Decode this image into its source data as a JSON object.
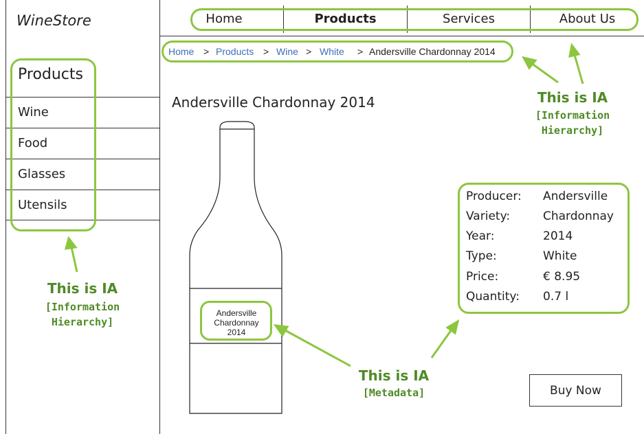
{
  "brand": "WineStore",
  "nav": [
    {
      "label": "Home",
      "active": false
    },
    {
      "label": "Products",
      "active": true
    },
    {
      "label": "Services",
      "active": false
    },
    {
      "label": "About Us",
      "active": false
    }
  ],
  "breadcrumb": {
    "links": [
      "Home",
      "Products",
      "Wine",
      "White"
    ],
    "separator": ">",
    "current": "Andersville Chardonnay 2014"
  },
  "sidebar": {
    "title": "Products",
    "items": [
      "Wine",
      "Food",
      "Glasses",
      "Utensils"
    ]
  },
  "product": {
    "title": "Andersville Chardonnay 2014",
    "bottle_label": [
      "Andersville",
      "Chardonnay",
      "2014"
    ],
    "metadata": [
      {
        "key": "Producer:",
        "value": "Andersville"
      },
      {
        "key": "Variety:",
        "value": "Chardonnay"
      },
      {
        "key": "Year:",
        "value": "2014"
      },
      {
        "key": "Type:",
        "value": "White"
      },
      {
        "key": "Price:",
        "value": "€ 8.95"
      },
      {
        "key": "Quantity:",
        "value": "0.7 l"
      }
    ],
    "buy_label": "Buy Now"
  },
  "annotations": {
    "sidebar": {
      "title": "This is IA",
      "subtitle_lines": [
        "[Information",
        "Hierarchy]"
      ]
    },
    "nav": {
      "title": "This is IA",
      "subtitle_lines": [
        "[Information",
        "Hierarchy]"
      ]
    },
    "metadata": {
      "title": "This is IA",
      "subtitle_lines": [
        "[Metadata]"
      ]
    }
  },
  "colors": {
    "annotation_green": "#8cc63f",
    "annotation_text": "#4f8a26",
    "link_blue": "#3d6fb6"
  }
}
